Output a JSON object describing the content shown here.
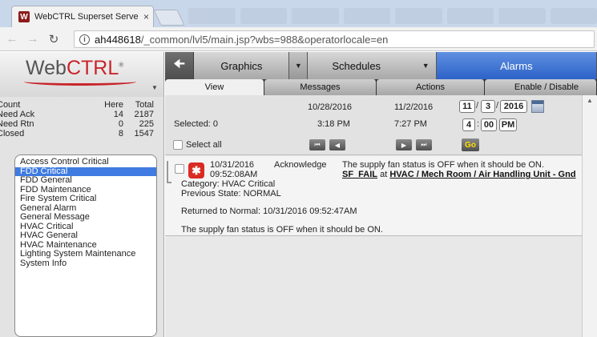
{
  "browser": {
    "tab_title": "WebCTRL Superset Serve",
    "tab_close": "×",
    "favicon": "W",
    "url_host": "ah448618",
    "url_path": "/_common/lvl5/main.jsp?wbs=988&operatorlocale=en"
  },
  "logo": {
    "web": "Web",
    "ctrl": "CTRL",
    "reg": "®"
  },
  "nav": {
    "graphics": "Graphics",
    "schedules": "Schedules",
    "alarms": "Alarms"
  },
  "subtabs": [
    "View",
    "Messages",
    "Actions",
    "Enable / Disable"
  ],
  "counts": {
    "headers": [
      "Count",
      "Here",
      "Total"
    ],
    "rows": [
      [
        "Need Ack",
        "14",
        "2187"
      ],
      [
        "Need Rtn",
        "0",
        "225"
      ],
      [
        "Closed",
        "8",
        "1547"
      ]
    ]
  },
  "categories": [
    "Access Control Critical",
    "FDD Critical",
    "FDD General",
    "FDD Maintenance",
    "Fire System Critical",
    "General Alarm",
    "General Message",
    "HVAC Critical",
    "HVAC General",
    "HVAC Maintenance",
    "Lighting System Maintenance",
    "System Info"
  ],
  "selected_category_index": 1,
  "controls": {
    "selected": "Selected: 0",
    "select_all": "Select all",
    "start_date": "10/28/2016",
    "start_time": "3:18 PM",
    "end_date": "11/2/2016",
    "end_time": "7:27 PM",
    "month": "11",
    "day": "3",
    "year": "2016",
    "hour": "4",
    "minute": "00",
    "ampm": "PM",
    "date_sep": "/",
    "time_sep": ":",
    "go": "Go"
  },
  "alarm": {
    "date": "10/31/2016",
    "time": "09:52:08AM",
    "action": "Acknowledge",
    "message": "The supply fan status is OFF when it should be ON.",
    "code": "SF_FAIL",
    "at": "at",
    "location": "HVAC / Mech Room / Air Handling Unit - Gnd",
    "category": "Category: HVAC Critical",
    "previous_state": "Previous State: NORMAL",
    "returned": "Returned to Normal: 10/31/2016 09:52:47AM",
    "detail": "The supply fan status is OFF when it should be ON."
  }
}
